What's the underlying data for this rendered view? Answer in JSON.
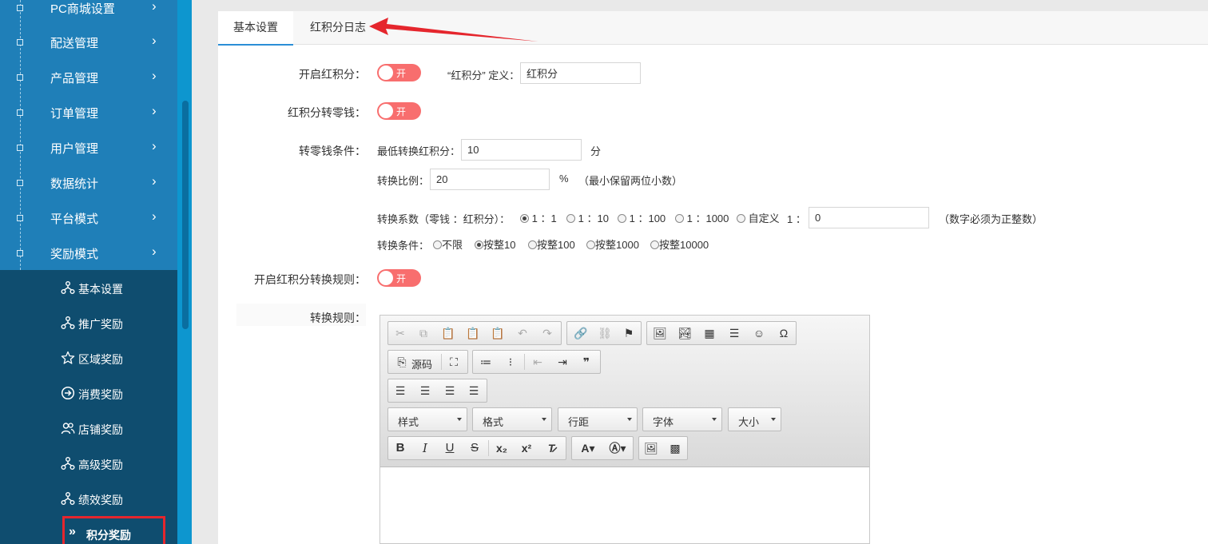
{
  "sidebar": {
    "menu": [
      {
        "label": "PC商城设置"
      },
      {
        "label": "配送管理"
      },
      {
        "label": "产品管理"
      },
      {
        "label": "订单管理"
      },
      {
        "label": "用户管理"
      },
      {
        "label": "数据统计"
      },
      {
        "label": "平台模式"
      },
      {
        "label": "奖励模式"
      }
    ],
    "submenu": [
      {
        "label": "基本设置",
        "icon": "sitemap-icon"
      },
      {
        "label": "推广奖励",
        "icon": "sitemap-icon"
      },
      {
        "label": "区域奖励",
        "icon": "star-icon"
      },
      {
        "label": "消费奖励",
        "icon": "arrow-circle-icon"
      },
      {
        "label": "店铺奖励",
        "icon": "users-icon"
      },
      {
        "label": "高级奖励",
        "icon": "sitemap-icon"
      },
      {
        "label": "绩效奖励",
        "icon": "sitemap-icon"
      }
    ],
    "active_item": {
      "label": "积分奖励",
      "icon": "double-chevron-icon"
    },
    "chevron": "›",
    "active_icon_glyph": "»"
  },
  "tabs": [
    {
      "label": "基本设置",
      "active": true
    },
    {
      "label": "红积分日志",
      "active": false
    }
  ],
  "form": {
    "enable_label": "开启红积分：",
    "toggle_on_text": "开",
    "define_label": "“红积分” 定义：",
    "define_value": "红积分",
    "to_change_label": "红积分转零钱：",
    "condition_label": "转零钱条件：",
    "min_label": "最低转换红积分：",
    "min_value": "10",
    "min_unit": "分",
    "ratio_label": "转换比例：",
    "ratio_value": "20",
    "ratio_unit": "%",
    "ratio_note": "（最小保留两位小数）",
    "coef_label": "转换系数（零钱 ：红积分）：",
    "coef_options": [
      "1 ：1",
      "1 ：10",
      "1 ：100",
      "1 ：1000",
      "自定义"
    ],
    "coef_selected": 0,
    "coef_custom_prefix": "1 ：",
    "coef_custom_value": "0",
    "coef_note": "（数字必须为正整数）",
    "cond_label": "转换条件：",
    "cond_options": [
      "不限",
      "按整10",
      "按整100",
      "按整1000",
      "按整10000"
    ],
    "cond_selected": 1,
    "rule_enable_label": "开启红积分转换规则：",
    "rule_label": "转换规则："
  },
  "editor": {
    "source_label": "源码",
    "combos": [
      "样式",
      "格式",
      "行距",
      "字体",
      "大小"
    ]
  },
  "colors": {
    "sidebar": "#1f7fb8",
    "submenu": "#0f4d6f",
    "toggle": "#f86e6e",
    "tab_active": "#2b8ed6",
    "highlight": "#e5262d"
  }
}
